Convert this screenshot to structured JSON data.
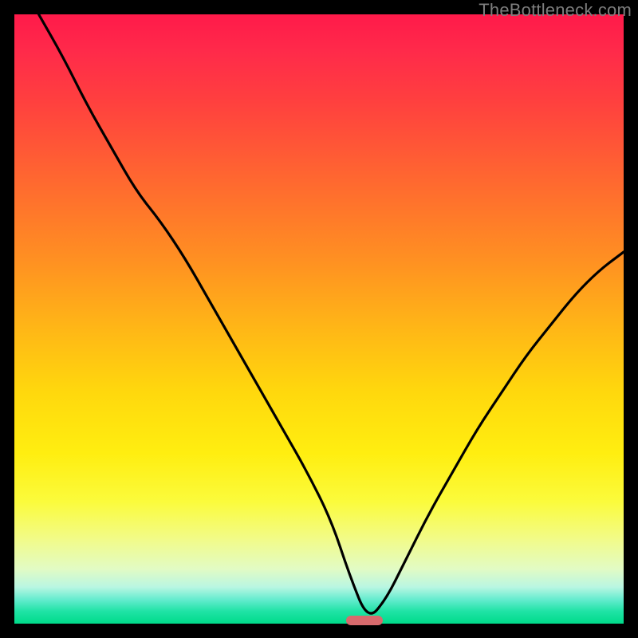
{
  "watermark": "TheBottleneck.com",
  "colors": {
    "frame": "#000000",
    "curve": "#000000",
    "marker": "#d86a6d"
  },
  "chart_data": {
    "type": "line",
    "title": "",
    "xlabel": "",
    "ylabel": "",
    "xlim": [
      0,
      100
    ],
    "ylim": [
      0,
      100
    ],
    "grid": false,
    "description": "V-shaped bottleneck curve over a vertical heat gradient (red=high bottleneck at top, green=low at bottom). The curve descends from top-left, reaches a minimum near x≈58 at y≈0, and rises to the right edge at y≈61. A small rounded marker sits at the minimum.",
    "series": [
      {
        "name": "bottleneck-curve",
        "x": [
          4,
          8,
          12,
          16,
          20,
          24,
          28,
          32,
          36,
          40,
          44,
          48,
          52,
          55,
          58,
          61,
          64,
          68,
          72,
          76,
          80,
          84,
          88,
          92,
          96,
          100
        ],
        "y": [
          100,
          93,
          85,
          78,
          71,
          66,
          60,
          53,
          46,
          39,
          32,
          25,
          17,
          8,
          0.5,
          4,
          10,
          18,
          25,
          32,
          38,
          44,
          49,
          54,
          58,
          61
        ]
      }
    ],
    "minimum_marker": {
      "x": 57.5,
      "y": 0.5,
      "width_pct": 6
    }
  }
}
